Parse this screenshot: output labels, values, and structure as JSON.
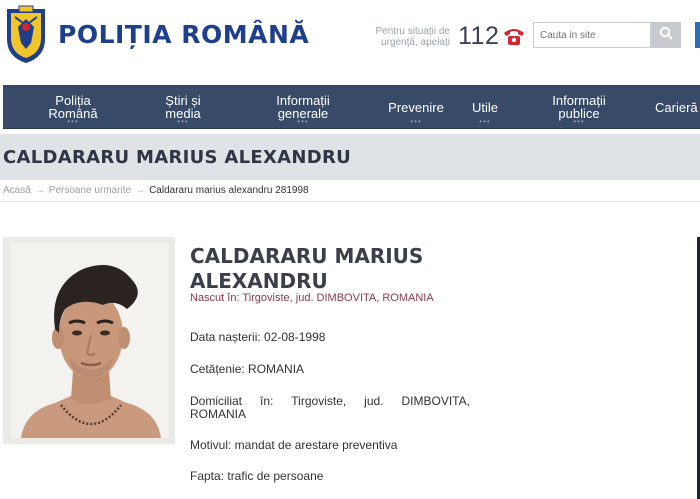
{
  "header": {
    "site_title": "POLIȚIA ROMÂNĂ",
    "emergency_text": "Pentru situații de urgență, apelați",
    "emergency_number": "112",
    "search_placeholder": "Cauta in site"
  },
  "nav": {
    "items": [
      {
        "line1": "Poliția",
        "line2": "Română"
      },
      {
        "line1": "Știri și",
        "line2": "media"
      },
      {
        "line1": "Informații",
        "line2": "generale"
      },
      {
        "line1": "Prevenire",
        "line2": ""
      },
      {
        "line1": "Utile",
        "line2": ""
      },
      {
        "line1": "Informații",
        "line2": "publice"
      },
      {
        "line1": "Carieră",
        "line2": ""
      }
    ]
  },
  "page_title": "CALDARARU MARIUS ALEXANDRU",
  "breadcrumb": {
    "home": "Acasă",
    "section": "Persoane urmarite",
    "current": "Caldararu marius alexandru 281998"
  },
  "person": {
    "name": "CALDARARU MARIUS ALEXANDRU",
    "birthplace": "Nascut în: Tirgoviste, jud. DIMBOVITA, ROMANIA",
    "birth_date": "Data nașterii: 02-08-1998",
    "citizenship": "Cetățenie: ROMANIA",
    "domicile_words": [
      "Domiciliat",
      "în:",
      "Tirgoviste,",
      "jud.",
      "DIMBOVITA,"
    ],
    "domicile_line2": "ROMANIA",
    "reason": "Motivul: mandat de arestare preventiva",
    "offense": "Fapta: trafic de persoane"
  },
  "colors": {
    "brand_blue": "#1d3f8c",
    "nav_bg": "#374a67",
    "title_band": "#dfe2e6",
    "birthplace_text": "#8a3a4a"
  },
  "icons": [
    "crest-icon",
    "phone-icon",
    "search-icon"
  ]
}
